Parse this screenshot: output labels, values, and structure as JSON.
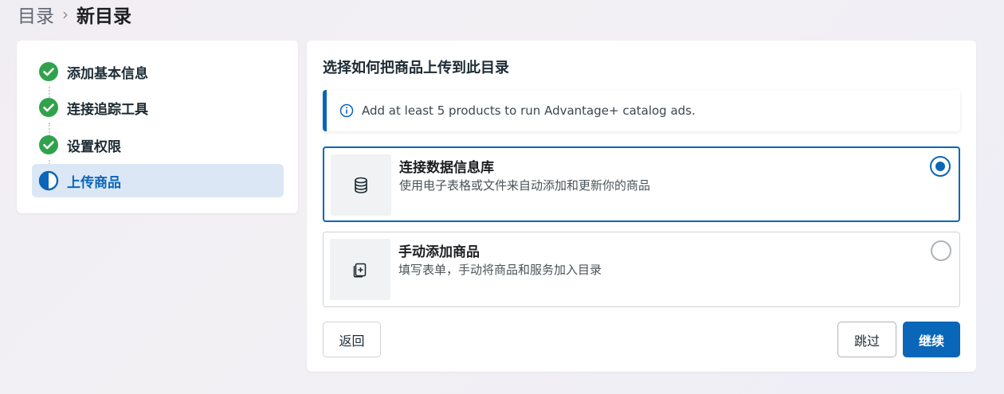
{
  "breadcrumb": {
    "parent": "目录",
    "separator": "›",
    "current": "新目录"
  },
  "steps": [
    {
      "label": "添加基本信息",
      "status": "complete"
    },
    {
      "label": "连接追踪工具",
      "status": "complete"
    },
    {
      "label": "设置权限",
      "status": "complete"
    },
    {
      "label": "上传商品",
      "status": "in-progress"
    }
  ],
  "main": {
    "title": "选择如何把商品上传到此目录",
    "notice": "Add at least 5 products to run Advantage+ catalog ads.",
    "options": [
      {
        "title": "连接数据信息库",
        "description": "使用电子表格或文件来自动添加和更新你的商品",
        "icon": "database-icon",
        "selected": true
      },
      {
        "title": "手动添加商品",
        "description": "填写表单，手动将商品和服务加入目录",
        "icon": "add-file-icon",
        "selected": false
      }
    ]
  },
  "buttons": {
    "back": "返回",
    "skip": "跳过",
    "continue": "继续"
  },
  "colors": {
    "accent": "#0a66b8",
    "complete": "#31a24c",
    "active_bg": "#dbe7f5"
  }
}
